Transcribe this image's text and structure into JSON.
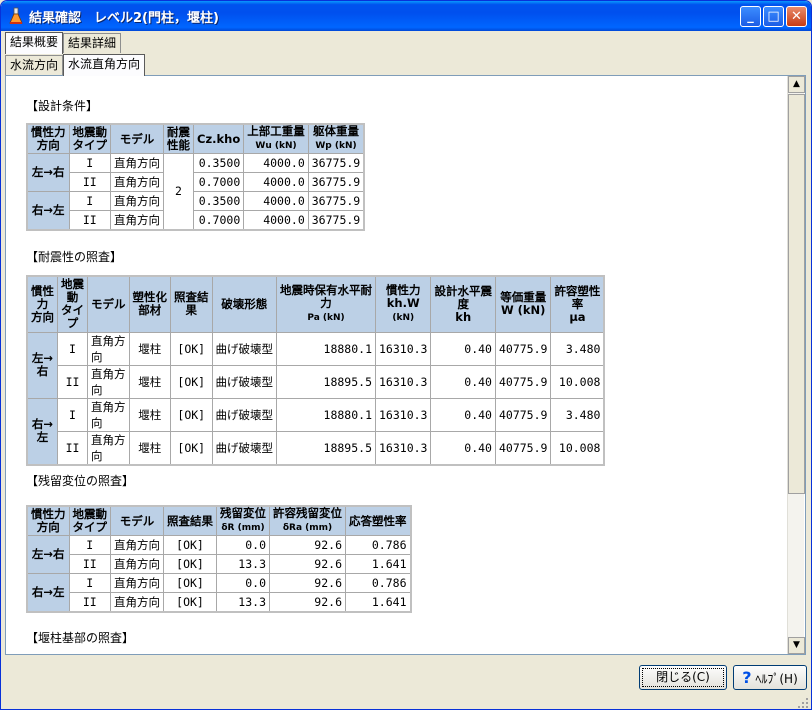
{
  "window": {
    "title": "結果確認　レベル2(門柱，堰柱)",
    "controls": {
      "minimize": "_",
      "maximize": "□",
      "close": "✕"
    }
  },
  "tabs": {
    "top": [
      {
        "label": "結果概要",
        "active": true
      },
      {
        "label": "結果詳細",
        "active": false
      }
    ],
    "sub": [
      {
        "label": "水流方向",
        "active": false
      },
      {
        "label": "水流直角方向",
        "active": true
      }
    ]
  },
  "sections": {
    "s1": "【設計条件】",
    "s2": "【耐震性の照査】",
    "s3": "【残留変位の照査】",
    "s4": "【堰柱基部の照査】"
  },
  "table1": {
    "headers": {
      "dir": "慣性力\n方向",
      "type": "地震動\nタイプ",
      "model": "モデル",
      "perf": "耐震\n性能",
      "cz": "Cz.kho",
      "wu": "上部工重量",
      "wu_unit": "Wu (kN)",
      "wp": "躯体重量",
      "wp_unit": "Wp (kN)"
    },
    "dirs": [
      "左→右",
      "右→左"
    ],
    "perf": "2",
    "rows": [
      {
        "type": "I",
        "model": "直角方向",
        "cz": "0.3500",
        "wu": "4000.0",
        "wp": "36775.9"
      },
      {
        "type": "II",
        "model": "直角方向",
        "cz": "0.7000",
        "wu": "4000.0",
        "wp": "36775.9"
      },
      {
        "type": "I",
        "model": "直角方向",
        "cz": "0.3500",
        "wu": "4000.0",
        "wp": "36775.9"
      },
      {
        "type": "II",
        "model": "直角方向",
        "cz": "0.7000",
        "wu": "4000.0",
        "wp": "36775.9"
      }
    ]
  },
  "table2": {
    "headers": {
      "dir": "慣性\n力\n方向",
      "type": "地震\n動\nタイ\nプ",
      "model": "モデル",
      "member": "塑性化\n部材",
      "result": "照査結\n果",
      "mode": "破壊形態",
      "pa": "地震時保有水平耐\n力",
      "pa_unit": "Pa (kN)",
      "kh": "慣性力\nkh.W",
      "kh_unit": "(kN)",
      "khc": "設計水平震\n度\nkh",
      "w": "等価重量\nW (kN)",
      "mu": "許容塑性\n率\nμa"
    },
    "dirs": [
      "左→\n右",
      "右→\n左"
    ],
    "rows": [
      {
        "type": "I",
        "model": "直角方\n向",
        "member": "堰柱",
        "result": "[OK]",
        "mode": "曲げ破壊型",
        "pa": "18880.1",
        "kh": "16310.3",
        "khc": "0.40",
        "w": "40775.9",
        "mu": "3.480"
      },
      {
        "type": "II",
        "model": "直角方\n向",
        "member": "堰柱",
        "result": "[OK]",
        "mode": "曲げ破壊型",
        "pa": "18895.5",
        "kh": "16310.3",
        "khc": "0.40",
        "w": "40775.9",
        "mu": "10.008"
      },
      {
        "type": "I",
        "model": "直角方\n向",
        "member": "堰柱",
        "result": "[OK]",
        "mode": "曲げ破壊型",
        "pa": "18880.1",
        "kh": "16310.3",
        "khc": "0.40",
        "w": "40775.9",
        "mu": "3.480"
      },
      {
        "type": "II",
        "model": "直角方\n向",
        "member": "堰柱",
        "result": "[OK]",
        "mode": "曲げ破壊型",
        "pa": "18895.5",
        "kh": "16310.3",
        "khc": "0.40",
        "w": "40775.9",
        "mu": "10.008"
      }
    ]
  },
  "table3": {
    "headers": {
      "dir": "慣性力\n方向",
      "type": "地震動\nタイプ",
      "model": "モデル",
      "result": "照査結果",
      "dr": "残留変位",
      "dr_unit": "δR (mm)",
      "dra": "許容残留変位",
      "dra_unit": "δRa (mm)",
      "mu": "応答塑性率"
    },
    "dirs": [
      "左→右",
      "右→左"
    ],
    "rows": [
      {
        "type": "I",
        "model": "直角方向",
        "result": "[OK]",
        "dr": "0.0",
        "dra": "92.6",
        "mu": "0.786"
      },
      {
        "type": "II",
        "model": "直角方向",
        "result": "[OK]",
        "dr": "13.3",
        "dra": "92.6",
        "mu": "1.641"
      },
      {
        "type": "I",
        "model": "直角方向",
        "result": "[OK]",
        "dr": "0.0",
        "dra": "92.6",
        "mu": "0.786"
      },
      {
        "type": "II",
        "model": "直角方向",
        "result": "[OK]",
        "dr": "13.3",
        "dra": "92.6",
        "mu": "1.641"
      }
    ]
  },
  "buttons": {
    "close": "閉じる(C)",
    "help": "ﾍﾙﾌﾟ(H)",
    "help_icon": "?"
  },
  "scrollbar": {
    "up": "▲",
    "down": "▼"
  }
}
